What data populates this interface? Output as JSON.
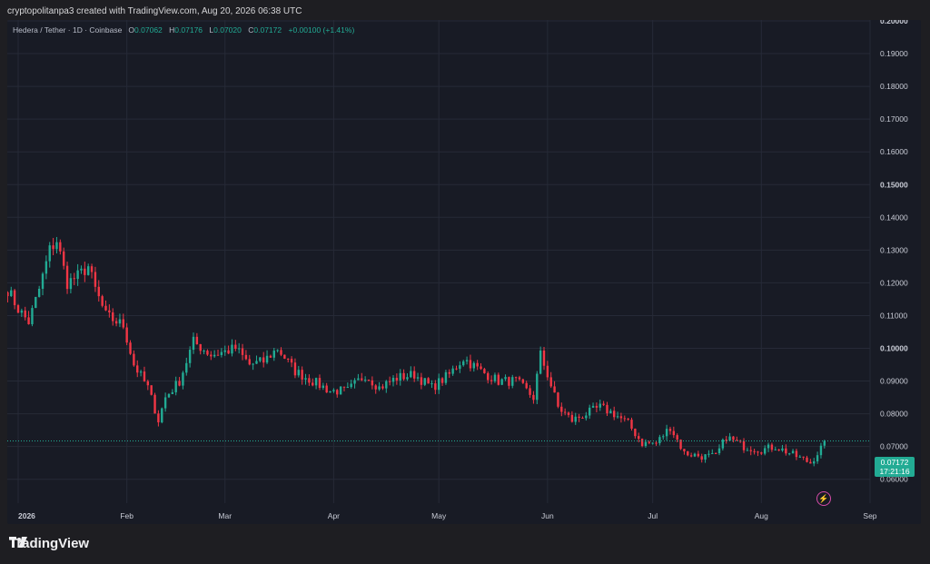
{
  "header": {
    "attribution": "cryptopolitanpa3 created with TradingView.com, Aug 20, 2026 06:38 UTC"
  },
  "legend": {
    "symbol": "Hedera / Tether · 1D · Coinbase",
    "open_label": "O",
    "open": "0.07062",
    "high_label": "H",
    "high": "0.07176",
    "low_label": "L",
    "low": "0.07020",
    "close_label": "C",
    "close": "0.07172",
    "change": "+0.00100 (+1.41%)"
  },
  "price_badge": {
    "price": "0.07172",
    "countdown": "17:21:16"
  },
  "brand": {
    "name": "TradingView"
  },
  "colors": {
    "up": "#22ab94",
    "down": "#f23645",
    "background": "#181b25",
    "grid": "#262a37",
    "alert": "#d54ba8"
  },
  "icons": {
    "alert": "lightning-bolt-icon",
    "logo": "tradingview-logo-icon"
  },
  "chart_data": {
    "type": "candlestick",
    "title": "Hedera / Tether · 1D · Coinbase",
    "ylim": [
      0.055,
      0.2
    ],
    "y_ticks": [
      "0.20000",
      "0.19000",
      "0.18000",
      "0.17000",
      "0.16000",
      "0.15000",
      "0.14000",
      "0.13000",
      "0.12000",
      "0.11000",
      "0.10000",
      "0.09000",
      "0.08000",
      "0.07000",
      "0.06000"
    ],
    "bold_ticks": [
      "0.20000",
      "0.15000",
      "0.10000"
    ],
    "x_ticks": [
      {
        "label": "2026",
        "day": 0,
        "bold": true
      },
      {
        "label": "Feb",
        "day": 31
      },
      {
        "label": "Mar",
        "day": 59
      },
      {
        "label": "Apr",
        "day": 90
      },
      {
        "label": "May",
        "day": 120
      },
      {
        "label": "Jun",
        "day": 151
      },
      {
        "label": "Jul",
        "day": 181
      },
      {
        "label": "Aug",
        "day": 212
      },
      {
        "label": "Sep",
        "day": 243
      }
    ],
    "start_day": -3,
    "last_price": 0.07172,
    "keyframes": [
      [
        -3,
        0.118
      ],
      [
        0,
        0.112
      ],
      [
        3,
        0.108
      ],
      [
        6,
        0.118
      ],
      [
        9,
        0.13
      ],
      [
        11,
        0.133
      ],
      [
        14,
        0.12
      ],
      [
        17,
        0.122
      ],
      [
        20,
        0.125
      ],
      [
        22,
        0.118
      ],
      [
        25,
        0.11
      ],
      [
        30,
        0.107
      ],
      [
        33,
        0.095
      ],
      [
        37,
        0.088
      ],
      [
        40,
        0.078
      ],
      [
        42,
        0.085
      ],
      [
        46,
        0.09
      ],
      [
        50,
        0.102
      ],
      [
        55,
        0.098
      ],
      [
        59,
        0.099
      ],
      [
        62,
        0.1
      ],
      [
        66,
        0.095
      ],
      [
        70,
        0.096
      ],
      [
        74,
        0.1
      ],
      [
        79,
        0.093
      ],
      [
        84,
        0.09
      ],
      [
        89,
        0.087
      ],
      [
        94,
        0.087
      ],
      [
        99,
        0.092
      ],
      [
        103,
        0.088
      ],
      [
        108,
        0.091
      ],
      [
        113,
        0.092
      ],
      [
        118,
        0.088
      ],
      [
        123,
        0.092
      ],
      [
        127,
        0.097
      ],
      [
        132,
        0.093
      ],
      [
        137,
        0.09
      ],
      [
        142,
        0.09
      ],
      [
        147,
        0.085
      ],
      [
        149,
        0.098
      ],
      [
        151,
        0.092
      ],
      [
        154,
        0.082
      ],
      [
        158,
        0.078
      ],
      [
        162,
        0.08
      ],
      [
        166,
        0.082
      ],
      [
        170,
        0.08
      ],
      [
        174,
        0.077
      ],
      [
        178,
        0.071
      ],
      [
        182,
        0.071
      ],
      [
        186,
        0.076
      ],
      [
        190,
        0.068
      ],
      [
        195,
        0.067
      ],
      [
        199,
        0.067
      ],
      [
        202,
        0.073
      ],
      [
        207,
        0.07
      ],
      [
        212,
        0.069
      ],
      [
        216,
        0.07
      ],
      [
        220,
        0.068
      ],
      [
        224,
        0.066
      ],
      [
        226,
        0.065
      ],
      [
        230,
        0.071
      ]
    ]
  }
}
